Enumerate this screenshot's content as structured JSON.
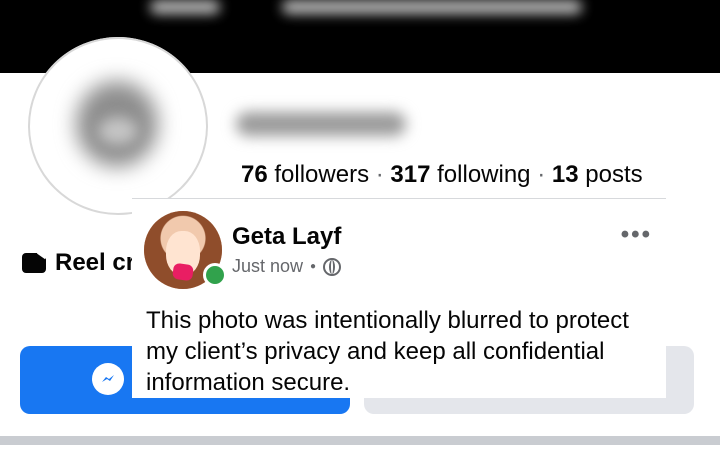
{
  "profile": {
    "stats": {
      "followers_count": "76",
      "followers_label": "followers",
      "separator": "·",
      "following_count": "317",
      "following_label": "following",
      "posts_count": "13",
      "posts_label": "posts"
    },
    "reel_label": "Reel cr"
  },
  "post": {
    "author": "Geta Layf",
    "time": "Just now",
    "visibility_icon": "globe-icon",
    "more_icon": "more-options-icon",
    "body": "This photo was intentionally blurred to protect my client’s privacy and keep all confidential information secure."
  },
  "colors": {
    "messenger_blue": "#1877f2",
    "online_green": "#31a24c",
    "secondary_button": "#e4e6eb"
  }
}
